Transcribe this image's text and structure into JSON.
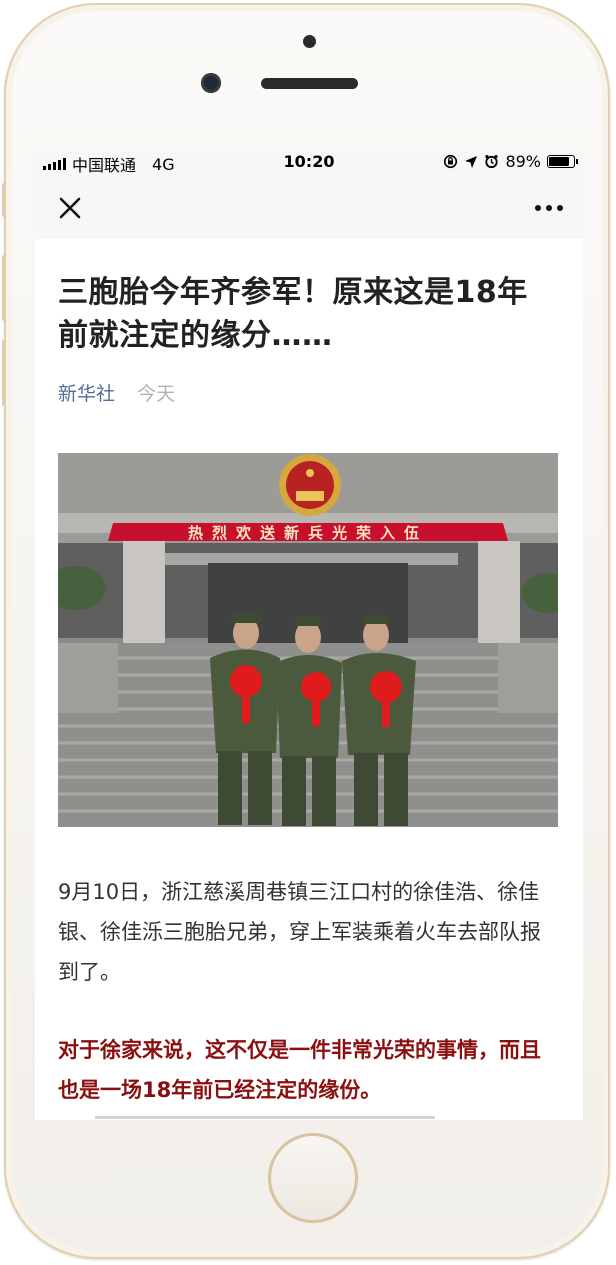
{
  "status_bar": {
    "carrier": "中国联通",
    "network": "4G",
    "time": "10:20",
    "battery_percent": "89%",
    "battery_level": 0.89
  },
  "nav": {
    "close_icon": "close-icon",
    "more_icon": "more-dots-icon"
  },
  "article": {
    "title": "三胞胎今年齐参军！原来这是18年前就注定的缘分……",
    "source": "新华社",
    "date": "今天",
    "image": {
      "banner_text": "热烈欢送新兵光荣入伍"
    },
    "paragraph_1": "9月10日，浙江慈溪周巷镇三江口村的徐佳浩、徐佳银、徐佳泺三胞胎兄弟，穿上军装乘着火车去部队报到了。",
    "paragraph_2": "对于徐家来说，这不仅是一件非常光荣的事情，而且也是一场18年前已经注定的缘份。"
  },
  "colors": {
    "source_link": "#576b95",
    "date_text": "#b2b2b2",
    "body_text": "#333333",
    "highlight_text": "#8b0f0f",
    "phone_frame": "#e3cfae",
    "banner_red": "#c8102e"
  }
}
